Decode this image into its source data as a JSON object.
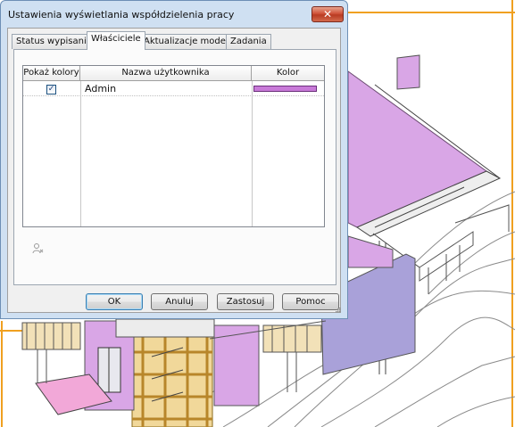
{
  "dialog": {
    "title": "Ustawienia wyświetlania współdzielenia pracy",
    "close_icon": "close-x-icon",
    "tabs": [
      {
        "label": "Status wypisania",
        "active": false
      },
      {
        "label": "Właściciele",
        "active": true
      },
      {
        "label": "Aktualizacje modelu",
        "active": false
      },
      {
        "label": "Zadania",
        "active": false
      }
    ],
    "table": {
      "columns": [
        "Pokaż kolory",
        "Nazwa użytkownika",
        "Kolor"
      ],
      "rows": [
        {
          "show_colors": true,
          "checkmark": "✓",
          "user": "Admin",
          "color": "#c87ad8"
        }
      ]
    },
    "remove_icon": "user-remove-icon",
    "buttons": {
      "ok": "OK",
      "cancel": "Anuluj",
      "apply": "Zastosuj",
      "help": "Pomoc"
    }
  },
  "viewport": {
    "background_icon": "building-3d-model-view",
    "highlight_color": "#d9a6e6",
    "secondary_color": "#a9a1d9",
    "frame_color": "#f0a020"
  }
}
